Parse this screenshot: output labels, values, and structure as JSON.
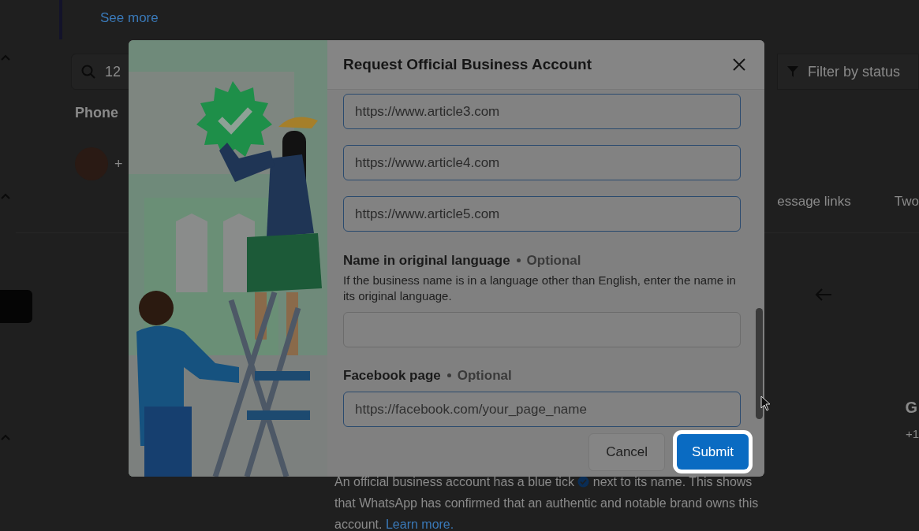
{
  "background": {
    "see_more": "See more",
    "search": {
      "value": "12"
    },
    "filter": {
      "placeholder": "Filter by status"
    },
    "section_title": "Phone",
    "contact_prefix": "+",
    "tabs": [
      {
        "label": "essage links"
      },
      {
        "label": "Two"
      }
    ],
    "detail_initial": "G",
    "detail_phone": "+1",
    "notice": {
      "before": "An official business account has a blue tick",
      "after": "next to its name. This shows that WhatsApp has confirmed that an authentic and notable brand owns this account.",
      "link": "Learn more."
    }
  },
  "dialog": {
    "title": "Request Official Business Account",
    "article_fields": [
      {
        "value": "https://www.article3.com"
      },
      {
        "value": "https://www.article4.com"
      },
      {
        "value": "https://www.article5.com"
      }
    ],
    "name_field": {
      "label": "Name in original language",
      "optional": "Optional",
      "help": "If the business name is in a language other than English, enter the name in its original language."
    },
    "facebook_field": {
      "label": "Facebook page",
      "optional": "Optional",
      "placeholder": "https://facebook.com/your_page_name"
    },
    "buttons": [
      {
        "label": "Cancel",
        "kind": "secondary"
      },
      {
        "label": "Submit",
        "kind": "primary"
      }
    ]
  }
}
